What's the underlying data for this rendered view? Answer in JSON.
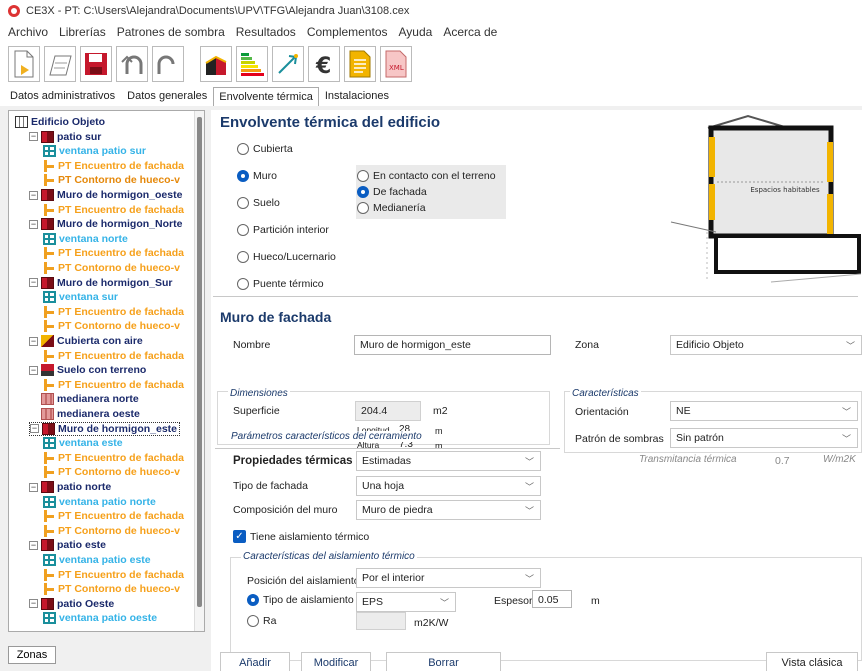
{
  "window": {
    "title": "CE3X - PT: C:\\Users\\Alejandra\\Documents\\UPV\\TFG\\Alejandra Juan\\3108.cex"
  },
  "menu": [
    "Archivo",
    "Librerías",
    "Patrones de sombra",
    "Resultados",
    "Complementos",
    "Ayuda",
    "Acerca de"
  ],
  "toolbar_icons": [
    "new-file-icon",
    "open-file-icon",
    "save-icon",
    "undo-icon",
    "redo-icon",
    "building-view-icon",
    "energy-rating-icon",
    "improvement-measures-icon",
    "economic-analysis-icon",
    "report-icon",
    "xml-export-icon"
  ],
  "tabs": [
    "Datos administrativos",
    "Datos generales",
    "Envolvente térmica",
    "Instalaciones"
  ],
  "tree": [
    {
      "label": "Edificio Objeto",
      "icon": "building",
      "level": 0,
      "color": "navy"
    },
    {
      "label": "patio sur",
      "icon": "wall",
      "level": 1,
      "color": "navy"
    },
    {
      "label": "ventana patio sur",
      "icon": "window",
      "level": 2,
      "color": "blue"
    },
    {
      "label": "PT Encuentro de fachada",
      "icon": "pt",
      "level": 2,
      "color": "orange"
    },
    {
      "label": "PT Contorno de hueco-v",
      "icon": "pt",
      "level": 2,
      "color": "orange2"
    },
    {
      "label": "Muro de hormigon_oeste",
      "icon": "wall",
      "level": 1,
      "color": "navy"
    },
    {
      "label": "PT Encuentro de fachada",
      "icon": "pt",
      "level": 2,
      "color": "orange"
    },
    {
      "label": "Muro de hormigon_Norte",
      "icon": "wall",
      "level": 1,
      "color": "navy"
    },
    {
      "label": "ventana norte",
      "icon": "window",
      "level": 2,
      "color": "blue"
    },
    {
      "label": "PT Encuentro de fachada",
      "icon": "pt",
      "level": 2,
      "color": "orange"
    },
    {
      "label": "PT Contorno de hueco-v",
      "icon": "pt",
      "level": 2,
      "color": "orange"
    },
    {
      "label": "Muro de hormigon_Sur",
      "icon": "wall",
      "level": 1,
      "color": "navy"
    },
    {
      "label": "ventana sur",
      "icon": "window",
      "level": 2,
      "color": "blue"
    },
    {
      "label": "PT Encuentro de fachada",
      "icon": "pt",
      "level": 2,
      "color": "orange"
    },
    {
      "label": "PT Contorno de hueco-v",
      "icon": "pt",
      "level": 2,
      "color": "orange"
    },
    {
      "label": "Cubierta con aire",
      "icon": "roof",
      "level": 1,
      "color": "navy"
    },
    {
      "label": "PT Encuentro de fachada",
      "icon": "pt",
      "level": 2,
      "color": "orange"
    },
    {
      "label": "Suelo con terreno",
      "icon": "floor",
      "level": 1,
      "color": "navy"
    },
    {
      "label": "PT Encuentro de fachada",
      "icon": "pt",
      "level": 2,
      "color": "orange"
    },
    {
      "label": "medianera norte",
      "icon": "medi",
      "level": 1,
      "color": "navy"
    },
    {
      "label": "medianera oeste",
      "icon": "medi",
      "level": 1,
      "color": "navy"
    },
    {
      "label": "Muro de hormigon_este",
      "icon": "wall",
      "level": 1,
      "color": "navy",
      "selected": true
    },
    {
      "label": "ventana este",
      "icon": "window",
      "level": 2,
      "color": "blue"
    },
    {
      "label": "PT Encuentro de fachada",
      "icon": "pt",
      "level": 2,
      "color": "orange"
    },
    {
      "label": "PT Contorno de hueco-v",
      "icon": "pt",
      "level": 2,
      "color": "orange"
    },
    {
      "label": "patio norte",
      "icon": "wall",
      "level": 1,
      "color": "navy"
    },
    {
      "label": "ventana patio norte",
      "icon": "window",
      "level": 2,
      "color": "blue"
    },
    {
      "label": "PT Encuentro de fachada",
      "icon": "pt",
      "level": 2,
      "color": "orange"
    },
    {
      "label": "PT Contorno de hueco-v",
      "icon": "pt",
      "level": 2,
      "color": "orange"
    },
    {
      "label": "patio este",
      "icon": "wall",
      "level": 1,
      "color": "navy"
    },
    {
      "label": "ventana patio este",
      "icon": "window",
      "level": 2,
      "color": "blue"
    },
    {
      "label": "PT Encuentro de fachada",
      "icon": "pt",
      "level": 2,
      "color": "orange"
    },
    {
      "label": "PT Contorno de hueco-v",
      "icon": "pt",
      "level": 2,
      "color": "orange"
    },
    {
      "label": "patio Oeste",
      "icon": "wall",
      "level": 1,
      "color": "navy"
    },
    {
      "label": "ventana patio oeste",
      "icon": "window",
      "level": 2,
      "color": "blue"
    }
  ],
  "zonas_tab": "Zonas",
  "envelope": {
    "title": "Envolvente térmica del edificio",
    "types": [
      {
        "label": "Cubierta",
        "selected": false
      },
      {
        "label": "Muro",
        "selected": true
      },
      {
        "label": "Suelo",
        "selected": false
      },
      {
        "label": "Partición interior",
        "selected": false
      },
      {
        "label": "Hueco/Lucernario",
        "selected": false
      },
      {
        "label": "Puente térmico",
        "selected": false
      }
    ],
    "wall_subtypes": [
      {
        "label": "En contacto con el terreno",
        "selected": false
      },
      {
        "label": "De fachada",
        "selected": true
      },
      {
        "label": "Medianería",
        "selected": false
      }
    ],
    "diagram_label": "Espacios habitables"
  },
  "form": {
    "title": "Muro de fachada",
    "nombre_label": "Nombre",
    "nombre_value": "Muro de hormigon_este",
    "zona_label": "Zona",
    "zona_value": "Edificio Objeto",
    "dimensiones_label": "Dimensiones",
    "superficie_label": "Superficie",
    "superficie_value": "204.4",
    "superficie_unit": "m2",
    "longitud_label": "Longitud",
    "longitud_value": "28",
    "longitud_unit": "m",
    "altura_label": "Altura",
    "altura_value": "7.3",
    "altura_unit": "m",
    "caracteristicas_label": "Características",
    "orientacion_label": "Orientación",
    "orientacion_value": "NE",
    "patron_label": "Patrón de sombras",
    "patron_value": "Sin patrón",
    "parametros_label": "Parámetros característicos del cerramiento",
    "propiedades_label": "Propiedades térmicas",
    "propiedades_value": "Estimadas",
    "transmitancia_label": "Transmitancia térmica",
    "transmitancia_value": "0.7",
    "transmitancia_unit": "W/m2K",
    "tipo_fachada_label": "Tipo de fachada",
    "tipo_fachada_value": "Una hoja",
    "composicion_label": "Composición del muro",
    "composicion_value": "Muro de piedra",
    "aislamiento_check_label": "Tiene aislamiento térmico",
    "aislamiento_caracteristicas_label": "Características del aislamiento térmico",
    "posicion_label": "Posición del aislamiento",
    "posicion_value": "Por el interior",
    "tipo_aislamiento_label": "Tipo de aislamiento",
    "tipo_aislamiento_value": "EPS",
    "espesor_label": "Espesor",
    "espesor_value": "0.05",
    "espesor_unit": "m",
    "ra_label": "Ra",
    "ra_unit": "m2K/W"
  },
  "buttons": {
    "anadir": "Añadir",
    "modificar": "Modificar",
    "borrar": "Borrar",
    "vista_clasica": "Vista clásica"
  }
}
